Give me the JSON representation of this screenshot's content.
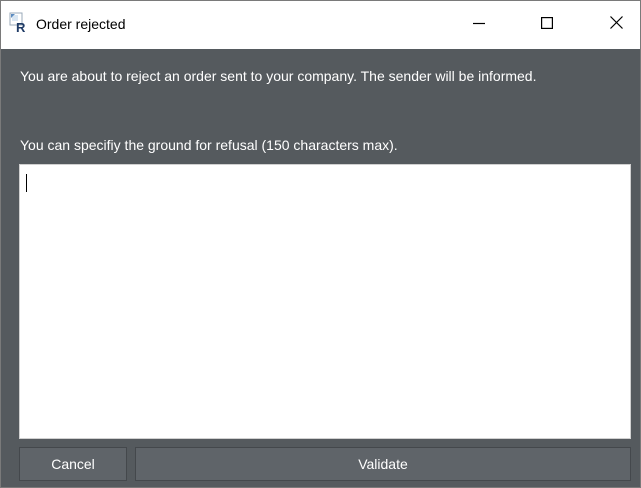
{
  "window": {
    "title": "Order rejected",
    "app_icon": "r-app-icon",
    "controls": {
      "minimize_icon": "minimize-icon",
      "maximize_icon": "maximize-icon",
      "close_icon": "close-icon"
    }
  },
  "dialog": {
    "message": "You are about to reject an order sent to your company. The sender will be informed.",
    "prompt": "You can specifiy the ground for refusal (150 characters max).",
    "reason_field": {
      "value": "",
      "placeholder": ""
    },
    "buttons": {
      "cancel_label": "Cancel",
      "validate_label": "Validate"
    }
  },
  "colors": {
    "dialog_background": "#555a5e",
    "button_background": "#5f6469",
    "text": "#ffffff",
    "titlebar": "#ffffff"
  }
}
